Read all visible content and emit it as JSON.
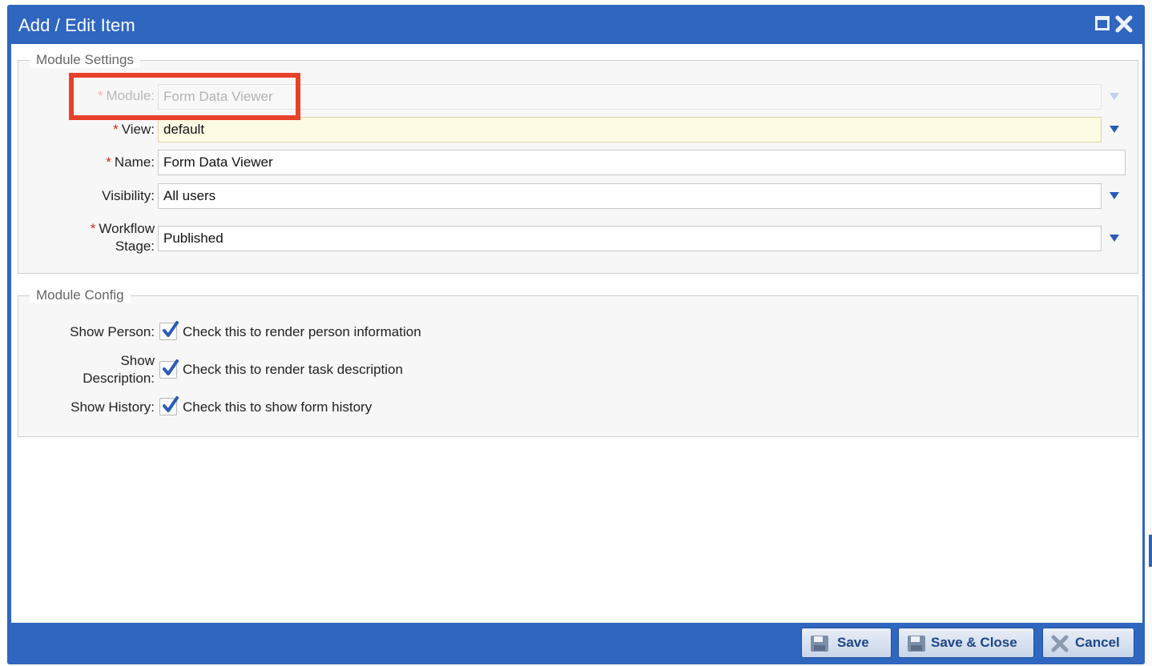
{
  "window": {
    "title": "Add / Edit Item"
  },
  "module_settings": {
    "legend": "Module Settings",
    "module": {
      "label": "Module:",
      "value": "Form Data Viewer",
      "required": true,
      "disabled": true
    },
    "view": {
      "label": "View:",
      "value": "default",
      "required": true
    },
    "name": {
      "label": "Name:",
      "value": "Form Data Viewer",
      "required": true
    },
    "visibility": {
      "label": "Visibility:",
      "value": "All users",
      "required": false
    },
    "workflow_stage": {
      "label_line1": "Workflow",
      "label_line2": "Stage:",
      "value": "Published",
      "required": true
    }
  },
  "module_config": {
    "legend": "Module Config",
    "show_person": {
      "label": "Show Person:",
      "checked": true,
      "text": "Check this to render person information"
    },
    "show_description": {
      "label_line1": "Show",
      "label_line2": "Description:",
      "checked": true,
      "text": "Check this to render task description"
    },
    "show_history": {
      "label": "Show History:",
      "checked": true,
      "text": "Check this to show form history"
    }
  },
  "required_marker": "*",
  "buttons": {
    "save": "Save",
    "save_close": "Save & Close",
    "cancel": "Cancel"
  },
  "colors": {
    "window_blue": "#2f66c0",
    "highlight_red": "#e8412a",
    "required_red": "#d9251c",
    "check_blue": "#2a5bb8"
  },
  "icons": {
    "maximize": "maximize-icon",
    "close": "close-icon",
    "save": "floppy-disk-icon",
    "cancel": "x-icon",
    "dropdown": "triangle-down-icon",
    "check": "checkmark-icon"
  }
}
